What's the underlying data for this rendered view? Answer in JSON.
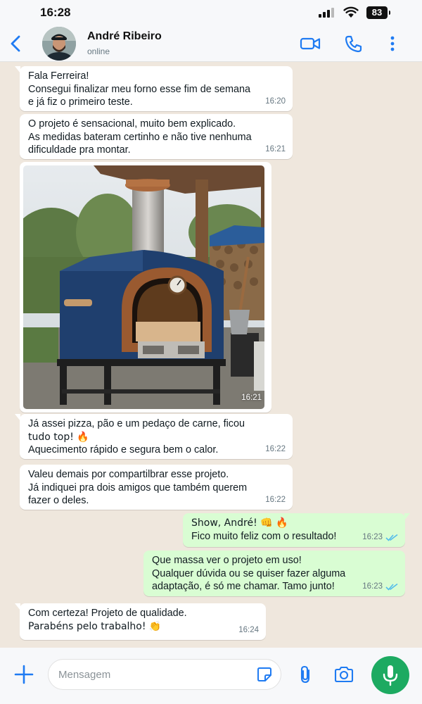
{
  "status_bar": {
    "time": "16:28",
    "battery": "83"
  },
  "header": {
    "contact_name": "André Ribeiro",
    "contact_status": "online",
    "accent_color": "#1f7bf2"
  },
  "messages": [
    {
      "dir": "in",
      "lines": [
        "Fala Ferreira!",
        "Consegui finalizar meu forno esse fim de semana",
        "e já fiz o primeiro teste."
      ],
      "time": "16:20"
    },
    {
      "dir": "in",
      "lines": [
        "O projeto é sensacional, muito bem explicado.",
        "As medidas bateram certinho e não tive nenhuma",
        "dificuldade pra montar."
      ],
      "time": "16:21"
    },
    {
      "dir": "in",
      "type": "image",
      "alt": "forno a lenha de alvenaria com chaminé e lenha ao fundo",
      "time": "16:21"
    },
    {
      "dir": "in",
      "lines": [
        "Já assei pizza, pão e um pedaço de carne, ficou",
        "tudo top! 🔥",
        "Aquecimento rápido e segura bem o calor."
      ],
      "time": "16:22"
    },
    {
      "dir": "in",
      "lines": [
        "Valeu demais por compartilbrar esse projeto.",
        "Já indiquei pra dois amigos que também querem",
        "fazer o deles."
      ],
      "time": "16:22"
    },
    {
      "dir": "out",
      "lines": [
        "Show, André! 👊 🔥",
        "Fico muito feliz com o resultado!"
      ],
      "time": "16:23",
      "read": true
    },
    {
      "dir": "out",
      "lines": [
        "Que massa ver o projeto em uso!",
        "Qualquer dúvida ou se quiser fazer alguma",
        "adaptação, é só me chamar. Tamo junto!"
      ],
      "time": "16:23",
      "read": true
    },
    {
      "dir": "in",
      "lines": [
        "Com certeza! Projeto de qualidade.",
        "Parabéns pelo trabalho! 👏"
      ],
      "time": "16:24"
    }
  ],
  "composer": {
    "placeholder": "Mensagem"
  },
  "icons": [
    "back-icon",
    "video-call-icon",
    "phone-icon",
    "more-icon",
    "plus-icon",
    "sticker-icon",
    "attach-icon",
    "camera-icon",
    "mic-icon",
    "read-receipt-icon"
  ],
  "colors": {
    "outgoing_bubble": "#d9fdd3",
    "incoming_bubble": "#ffffff",
    "wallpaper": "#efe7dd",
    "mic_button": "#1daa61",
    "read_ticks": "#53bdeb"
  }
}
